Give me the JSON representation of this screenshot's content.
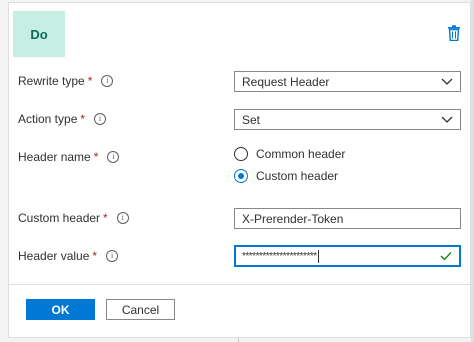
{
  "avatar": {
    "text": "Do"
  },
  "form": {
    "rewrite_type": {
      "label": "Rewrite type",
      "required": "*",
      "value": "Request Header"
    },
    "action_type": {
      "label": "Action type",
      "required": "*",
      "value": "Set"
    },
    "header_name": {
      "label": "Header name",
      "required": "*",
      "options": [
        "Common header",
        "Custom header"
      ],
      "selected": "Custom header"
    },
    "custom_header": {
      "label": "Custom header",
      "required": "*",
      "value": "X-Prerender-Token"
    },
    "header_value": {
      "label": "Header value",
      "required": "*",
      "value": "**********************"
    }
  },
  "buttons": {
    "ok": "OK",
    "cancel": "Cancel"
  },
  "icons": {
    "info": "i"
  },
  "colors": {
    "accent": "#0078d4",
    "required": "#a4262c",
    "avatar_bg": "#c7eee3",
    "valid": "#107c10"
  }
}
